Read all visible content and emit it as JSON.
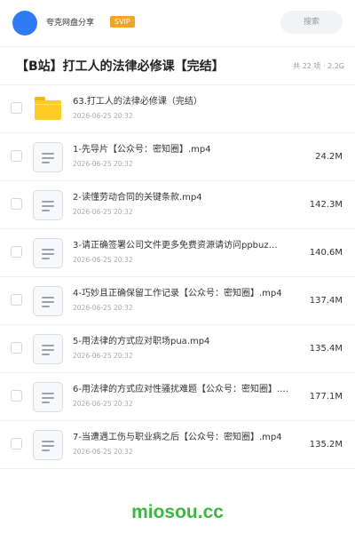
{
  "header": {
    "app_name": "夸克网盘分享",
    "vip_badge": "SVIP",
    "search_placeholder": "搜索"
  },
  "folder": {
    "title": "【B站】打工人的法律必修课【完结】",
    "meta": "共 22 项 · 2.2G"
  },
  "files": [
    {
      "type": "folder",
      "icon": "folder-icon",
      "name": "63.打工人的法律必修课（完结）",
      "date": "2026-06-25 20:32",
      "size": ""
    },
    {
      "type": "file",
      "icon": "file-icon",
      "name": "1-先导片【公众号：密知圈】.mp4",
      "date": "2026-06-25 20:32",
      "size": "24.2M"
    },
    {
      "type": "file",
      "icon": "file-icon",
      "name": "2-读懂劳动合同的关键条款.mp4",
      "date": "2026-06-25 20:32",
      "size": "142.3M"
    },
    {
      "type": "file",
      "icon": "file-icon",
      "name": "3-请正确签署公司文件更多免费资源请访问ppbuz…",
      "date": "2026-06-25 20:32",
      "size": "140.6M"
    },
    {
      "type": "file",
      "icon": "file-icon",
      "name": "4-巧妙且正确保留工作记录【公众号：密知圈】.mp4",
      "date": "2026-06-25 20:32",
      "size": "137.4M"
    },
    {
      "type": "file",
      "icon": "file-icon",
      "name": "5-用法律的方式应对职场pua.mp4",
      "date": "2026-06-25 20:32",
      "size": "135.4M"
    },
    {
      "type": "file",
      "icon": "file-icon",
      "name": "6-用法律的方式应对性骚扰难题【公众号：密知圈】.…",
      "date": "2026-06-25 20:32",
      "size": "177.1M"
    },
    {
      "type": "file",
      "icon": "file-icon",
      "name": "7-当遭遇工伤与职业病之后【公众号：密知圈】.mp4",
      "date": "2026-06-25 20:32",
      "size": "135.2M"
    }
  ],
  "watermark": "miosou.cc",
  "colors": {
    "avatar": "#2f7bf5",
    "vip_badge": "#f0a42a",
    "folder": "#ffcc26",
    "watermark": "#3fb542"
  }
}
